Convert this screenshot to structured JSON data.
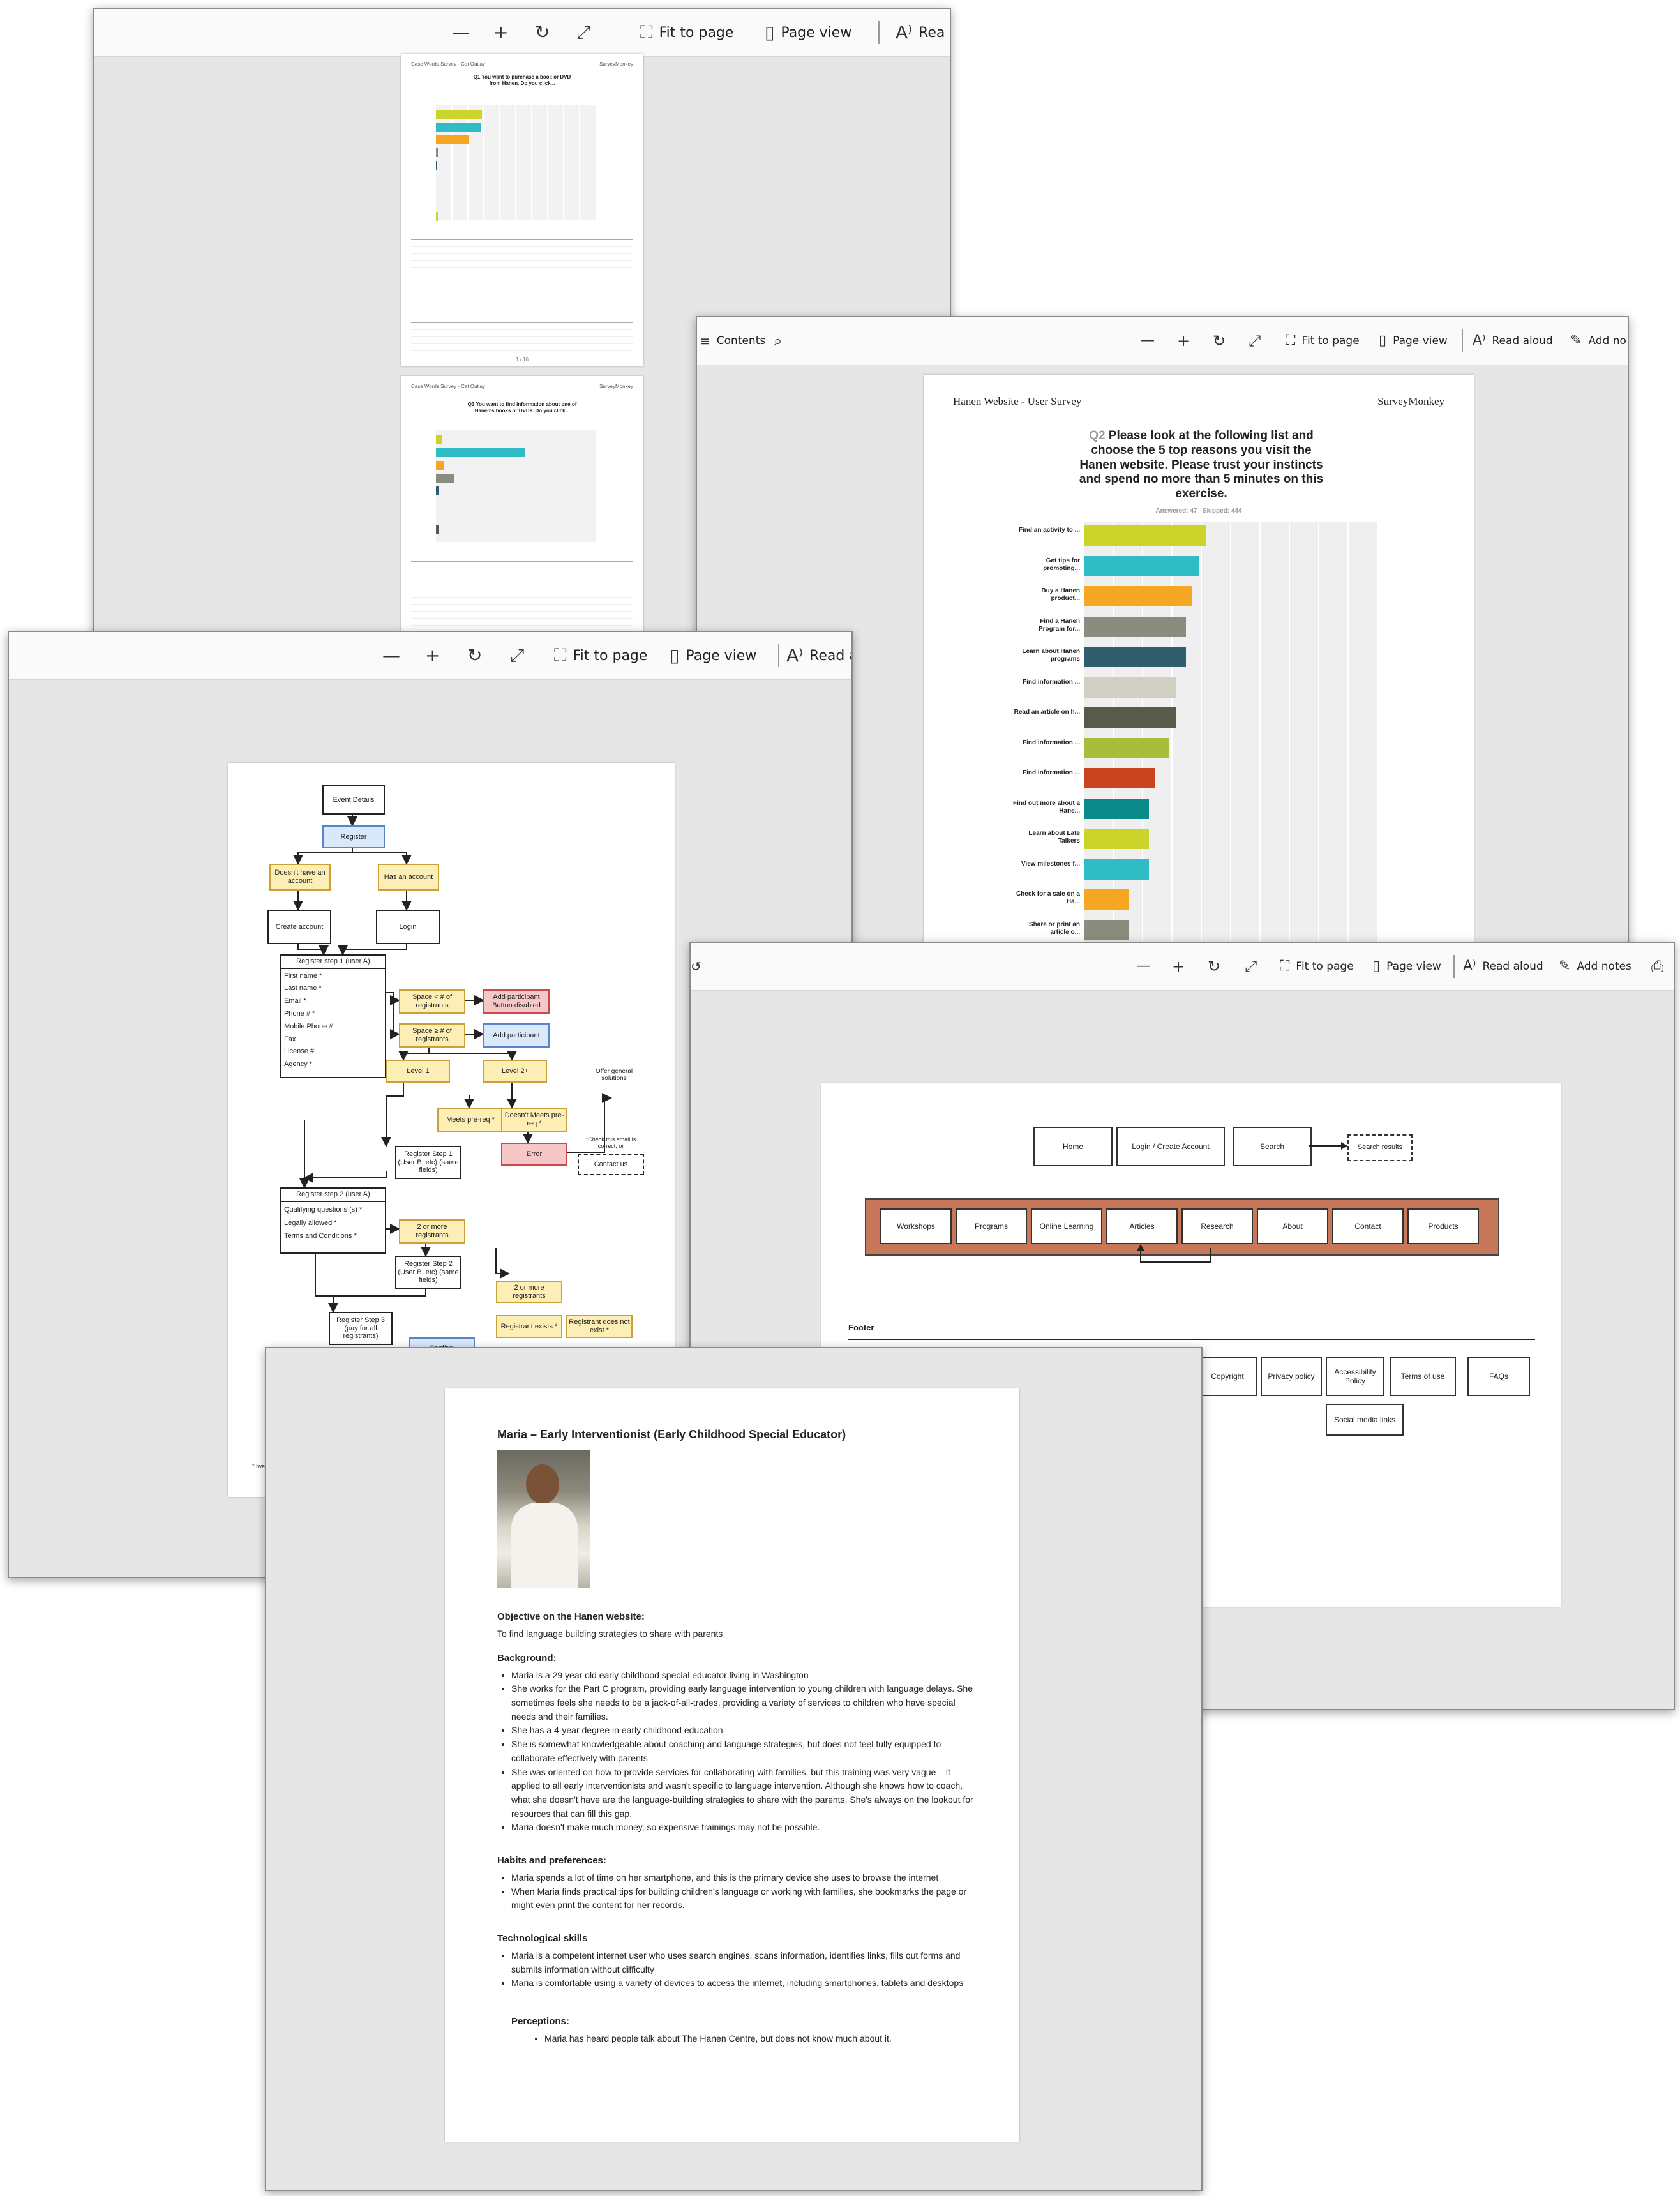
{
  "toolbar": {
    "contents": "Contents",
    "fit_to_page": "Fit to page",
    "page_view": "Page view",
    "read_aloud": "Read aloud",
    "read_aloud_cut_1": "Rea",
    "read_aloud_cut_3": "Read a",
    "add_notes": "Add notes",
    "add_notes_cut": "Add no"
  },
  "survey_small": {
    "header_left": "Case Words Survey - Cat Outlay",
    "header_right": "SurveyMonkey",
    "q1_title": "Q1 You want to purchase a book or DVD from Hanen. Do you click...",
    "q3_title": "Q3 You want to find information about one of Hanen's books or DVDs. Do you click...",
    "page_num": "1 / 16"
  },
  "survey_chart_doc": {
    "header_left": "Hanen Website - User Survey",
    "header_right": "SurveyMonkey",
    "q_num": "Q2",
    "question": "Please look at the following list and choose the 5 top reasons you visit the Hanen website. Please trust your instincts and spend no more than 5 minutes on this exercise.",
    "answered": "Answered: 47",
    "skipped": "Skipped: 444"
  },
  "chart_data": {
    "type": "bar",
    "orientation": "horizontal",
    "categories": [
      "Find an activity to ...",
      "Get tips for promoting...",
      "Buy a Hanen product...",
      "Find a Hanen Program for...",
      "Learn about Hanen programs",
      "Find information ...",
      "Read an article on h...",
      "Find information ...",
      "Find information ...",
      "Find out more about a Hane...",
      "Learn about Late Talkers",
      "View milestones f...",
      "Check for a sale on a Ha...",
      "Share or print an article o..."
    ],
    "values": [
      36,
      34,
      32,
      30,
      30,
      27,
      27,
      25,
      21,
      19,
      19,
      19,
      13,
      13
    ],
    "colors": [
      "#cbd42a",
      "#2fbcc4",
      "#f5a623",
      "#8c8c7e",
      "#2f5f6e",
      "#d0cfc2",
      "#5a5a4a",
      "#a8bd3a",
      "#c8451e",
      "#0b8a8a",
      "#cbd42a",
      "#2fbcc4",
      "#f5a623",
      "#8c8c7e"
    ],
    "xlim": [
      0,
      100
    ]
  },
  "flow": {
    "event_details": "Event Details",
    "register": "Register",
    "no_account": "Doesn't have an account",
    "has_account": "Has an account",
    "create_account": "Create account",
    "login": "Login",
    "step1_title": "Register step 1 (user A)",
    "step1_fields": [
      "First name *",
      "Last name *",
      "Email *",
      "Phone # *",
      "Mobile Phone #",
      "Fax",
      "License #",
      "Agency *"
    ],
    "space_lt": "Space < # of registrants",
    "space_ge": "Space ≥ # of registrants",
    "add_disabled": "Add participant Button disabled",
    "add_participant": "Add participant",
    "level1": "Level 1",
    "level2": "Level 2+",
    "meets": "Meets pre-req *",
    "not_meets": "Doesn't Meets pre-req *",
    "error": "Error",
    "offer": "Offer general solutions",
    "check_email": "*Check this email is correct, or",
    "contact_us": "Contact us",
    "step1_user_b": "Register Step 1 (User B, etc) (same fields)",
    "step2_title": "Register step 2 (user A)",
    "step2_fields": [
      "Qualifying questions (s) *",
      "Legally allowed *",
      "Terms and Conditions *"
    ],
    "two_more": "2 or more registrants",
    "step2_user_b": "Register Step 2 (User B, etc) (same fields)",
    "step3": "Register Step 3 (pay for all registrants)",
    "two_more_b": "2 or more registrants",
    "reg_exists": "Registrant exists *",
    "reg_not_exist": "Registrant does not exist *",
    "confirm": "Confirm",
    "footnote": "* Iwe"
  },
  "sitemap": {
    "top": [
      "Home",
      "Login / Create Account",
      "Search"
    ],
    "search_results": "Search results",
    "nav": [
      "Workshops",
      "Programs",
      "Online Learning",
      "Articles",
      "Research",
      "About",
      "Contact",
      "Products"
    ],
    "footer_label": "Footer",
    "footer": [
      "Copyright",
      "Privacy policy",
      "Accessibility Policy",
      "Terms of use",
      "FAQs"
    ],
    "social": "Social media links"
  },
  "persona": {
    "title": "Maria – Early Interventionist (Early Childhood Special Educator)",
    "objective_h": "Objective on the Hanen website:",
    "objective": "To find language building strategies to share with parents",
    "background_h": "Background:",
    "background": [
      "Maria is a 29 year old early childhood special educator living in Washington",
      "She works for the Part C program, providing early language intervention to young children with language delays. She sometimes feels she needs to be a jack-of-all-trades, providing a variety of services to children who have special needs and their families.",
      "She has a 4-year degree in early childhood education",
      "She is somewhat knowledgeable about coaching and language strategies, but does not feel fully equipped to collaborate effectively with parents",
      "She was oriented on how to provide services for collaborating with families, but this training was very vague – it applied to all early interventionists and wasn't specific to language intervention. Although she knows how to coach, what she doesn't have are the language-building strategies to share with the parents. She's always on the lookout for resources that can fill this gap.",
      "Maria doesn't make much money, so expensive trainings may not be possible."
    ],
    "habits_h": "Habits and preferences:",
    "habits": [
      "Maria spends a lot of time on her smartphone, and this is the primary device she uses to browse the internet",
      "When Maria finds practical tips for building children's language or working with families, she bookmarks the page or might even print the content for her records."
    ],
    "tech_h": "Technological skills",
    "tech": [
      "Maria is a competent internet user who uses search engines, scans information, identifies links, fills out forms and submits information without difficulty",
      "Maria is comfortable using a variety of devices to access the internet, including smartphones, tablets and desktops"
    ],
    "perceptions_h": "Perceptions:",
    "perceptions": [
      "Maria has heard people talk about The Hanen Centre, but does not know much about it."
    ]
  }
}
